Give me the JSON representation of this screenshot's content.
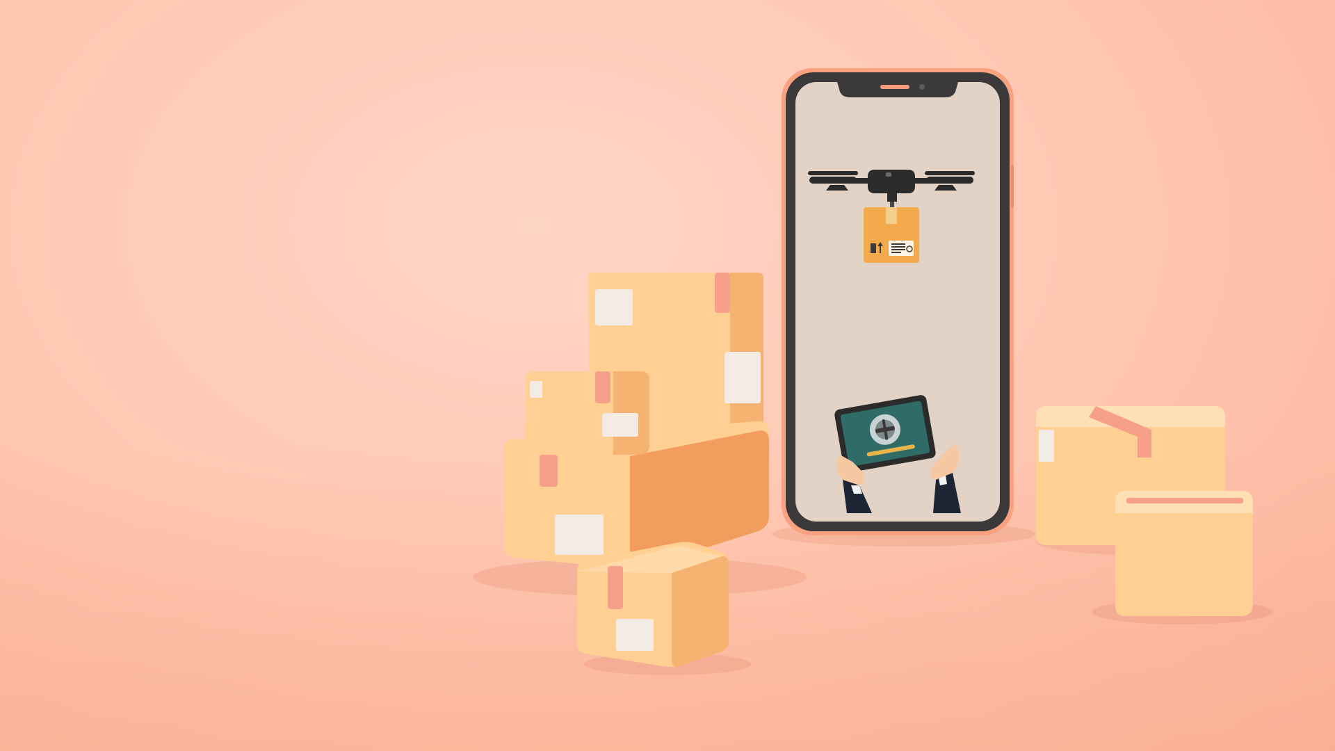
{
  "scene": {
    "colors": {
      "background": "#ffc9b4",
      "box_side": "#f3ab6e",
      "box_front": "#ffcf94",
      "box_top": "#ffe0b5",
      "tape": "#f6a089",
      "label": "#f3ebe4",
      "phone_frame": "#f8a282",
      "phone_bezel": "#3b3939",
      "phone_screen": "#e3d2c6",
      "drone": "#2b2b2b",
      "parcel": "#f2aa4c",
      "tablet_screen": "#2f6c68",
      "sleeve": "#1d2433",
      "skin": "#f6c8a1"
    },
    "icons": [
      "drone-icon",
      "parcel-icon",
      "tablet-icon",
      "hands-icon"
    ]
  }
}
